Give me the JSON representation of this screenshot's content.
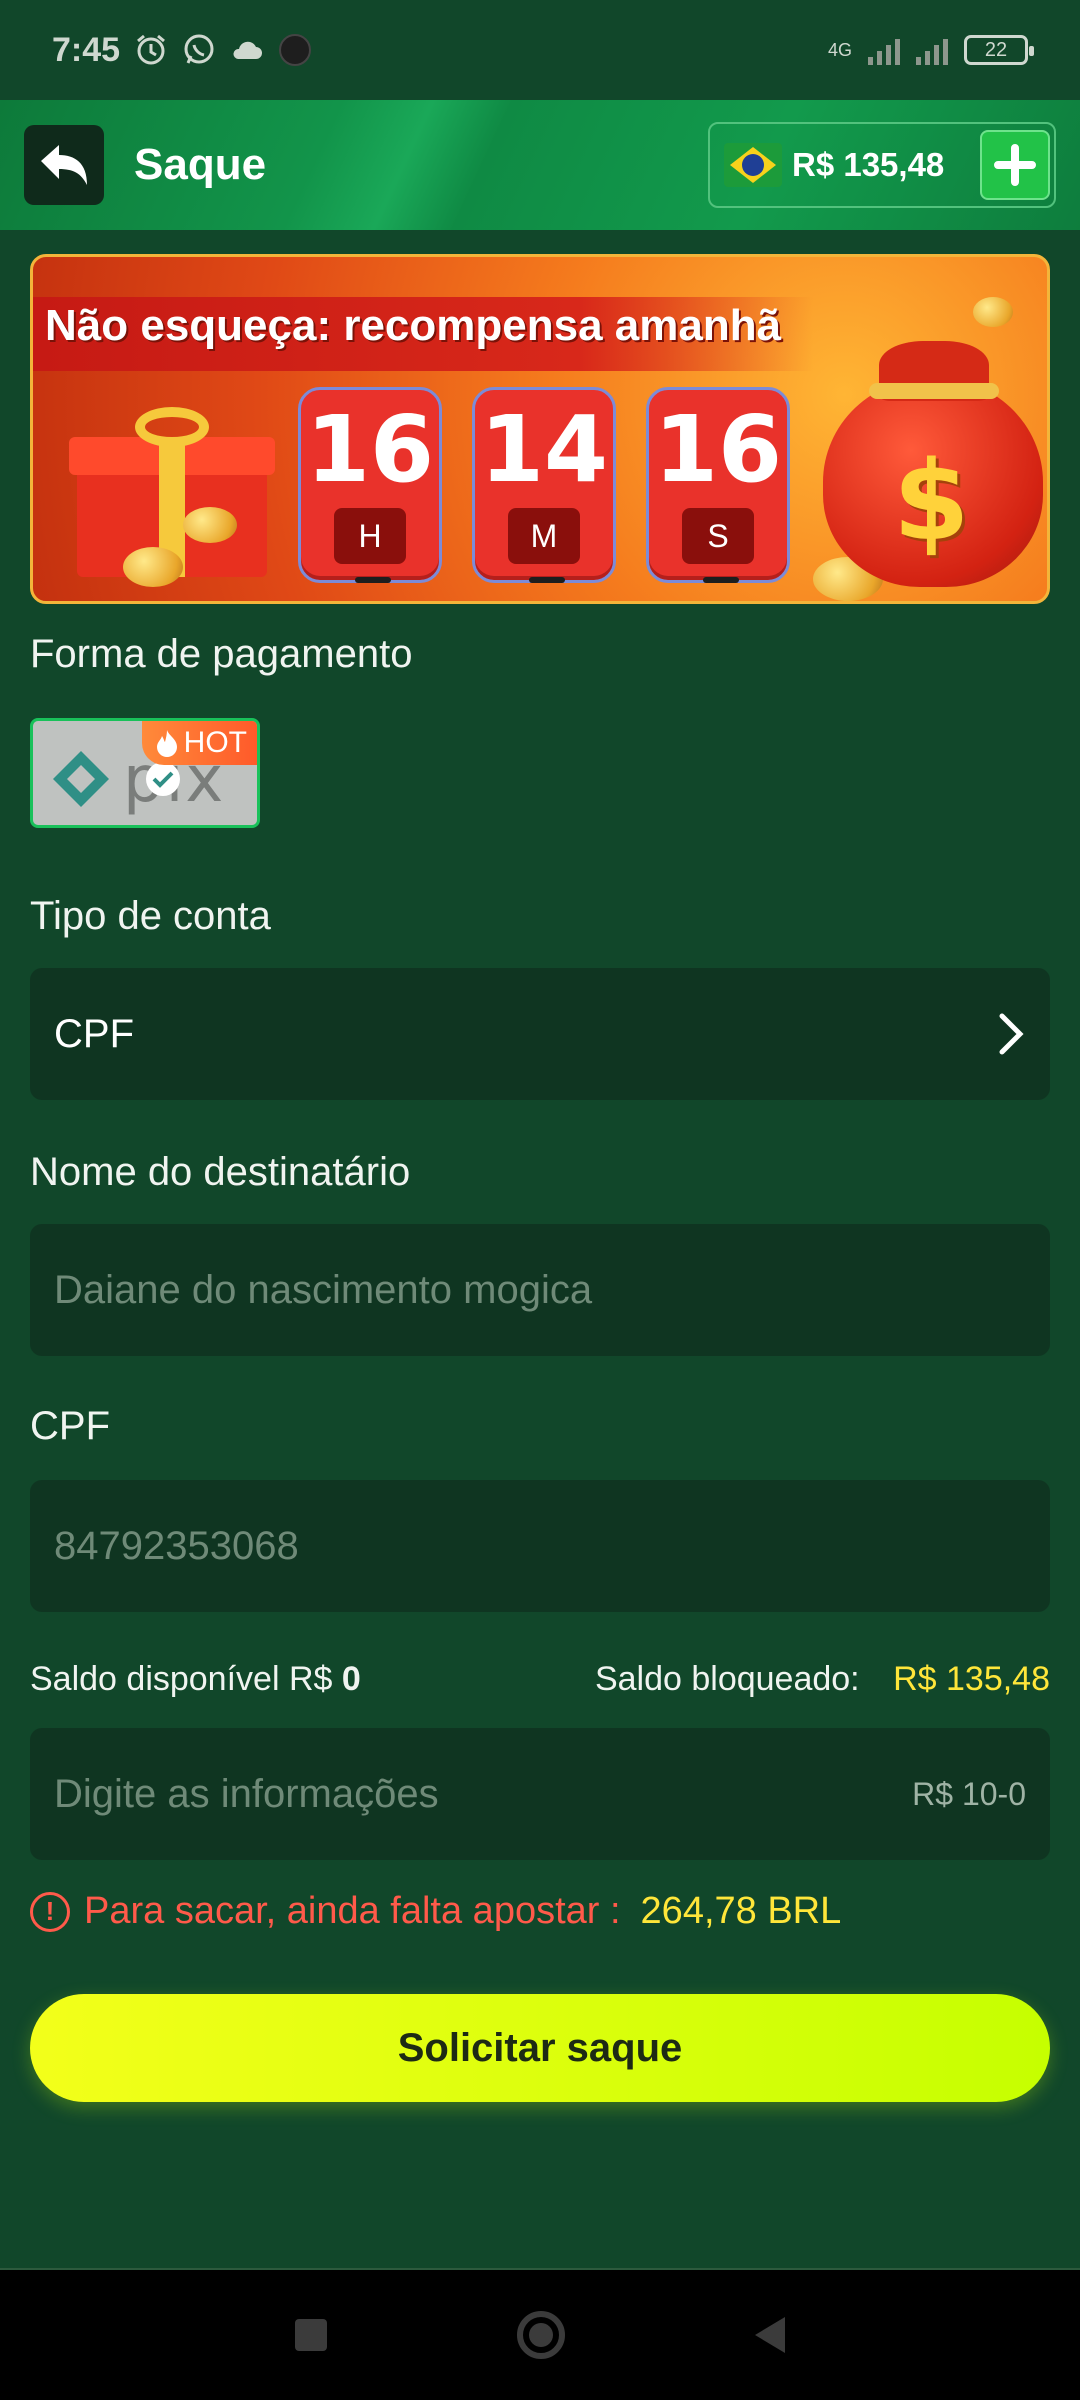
{
  "status_bar": {
    "time": "7:45",
    "network": "4G",
    "battery": "22",
    "icons": [
      "alarm-icon",
      "whatsapp-icon",
      "cloud-icon",
      "app-icon"
    ]
  },
  "header": {
    "title": "Saque",
    "balance": "R$ 135,48",
    "flag": "brazil-flag"
  },
  "banner": {
    "title": "Não esqueça: recompensa amanhã",
    "timer": [
      {
        "value": "16",
        "unit": "H"
      },
      {
        "value": "14",
        "unit": "M"
      },
      {
        "value": "16",
        "unit": "S"
      }
    ]
  },
  "form": {
    "payment_label": "Forma de pagamento",
    "payment_method": {
      "name": "pix",
      "badge": "HOT",
      "selected": true
    },
    "account_type_label": "Tipo de conta",
    "account_type_value": "CPF",
    "recipient_label": "Nome do destinatário",
    "recipient_placeholder": "Daiane do nascimento mogica",
    "cpf_label": "CPF",
    "cpf_placeholder": "84792353068",
    "saldo_disponivel_label": "Saldo disponível R$",
    "saldo_disponivel_value": "0",
    "saldo_bloqueado_label": "Saldo bloqueado:",
    "saldo_bloqueado_value": "R$ 135,48",
    "amount_placeholder": "Digite as informações",
    "amount_range": "R$ 10-0",
    "warning_text": "Para sacar, ainda falta apostar :",
    "warning_amount": "264,78 BRL",
    "submit_label": "Solicitar saque"
  },
  "colors": {
    "background": "#11472a",
    "header": "#129a4c",
    "accent_yellow": "#ffe63a",
    "warning_red": "#ff5a4a",
    "button": "#d8ff0a"
  }
}
